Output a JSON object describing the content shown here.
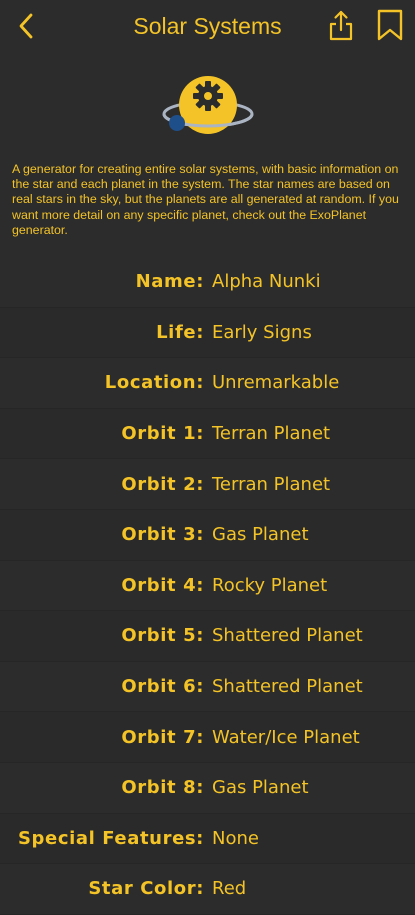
{
  "header": {
    "title": "Solar Systems",
    "back_icon": "chevron-left-icon",
    "share_icon": "share-icon",
    "bookmark_icon": "bookmark-icon"
  },
  "logo": {
    "icon": "planet-gear-icon",
    "colors": {
      "planet": "#f3c327",
      "ring": "#aab4c2",
      "moon": "#1f4f8a",
      "gear": "#2c2c2c"
    }
  },
  "description": "A generator for creating entire solar systems, with basic information on the star and each planet in the system. The star names are based on real stars in the sky, but the planets are all generated at random. If you want more detail on any specific planet, check out the ExoPlanet generator.",
  "fields": [
    {
      "label": "Name:",
      "value": "Alpha Nunki"
    },
    {
      "label": "Life:",
      "value": "Early Signs"
    },
    {
      "label": "Location:",
      "value": "Unremarkable"
    },
    {
      "label": "Orbit 1:",
      "value": "Terran Planet"
    },
    {
      "label": "Orbit 2:",
      "value": "Terran Planet"
    },
    {
      "label": "Orbit 3:",
      "value": "Gas Planet"
    },
    {
      "label": "Orbit 4:",
      "value": "Rocky Planet"
    },
    {
      "label": "Orbit 5:",
      "value": "Shattered Planet"
    },
    {
      "label": "Orbit 6:",
      "value": "Shattered Planet"
    },
    {
      "label": "Orbit 7:",
      "value": "Water/Ice Planet"
    },
    {
      "label": "Orbit 8:",
      "value": "Gas Planet"
    },
    {
      "label": "Special Features:",
      "value": "None"
    },
    {
      "label": "Star Color:",
      "value": "Red"
    }
  ],
  "colors": {
    "background": "#2c2c2c",
    "accent": "#f3c327"
  }
}
